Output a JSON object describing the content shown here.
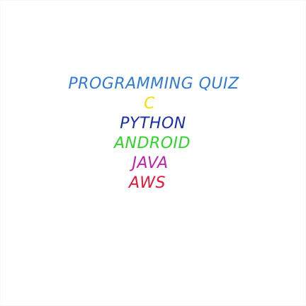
{
  "title": {
    "text": "PROGRAMMING QUIZ",
    "color": "#2e7bd8"
  },
  "menu": {
    "items": [
      {
        "label": "C",
        "color": "#f2e200"
      },
      {
        "label": "PYTHON",
        "color": "#1a2ea8"
      },
      {
        "label": "ANDROID",
        "color": "#2ed52a"
      },
      {
        "label": "JAVA",
        "color": "#c01fb0"
      },
      {
        "label": "AWS",
        "color": "#e8163a"
      }
    ]
  }
}
